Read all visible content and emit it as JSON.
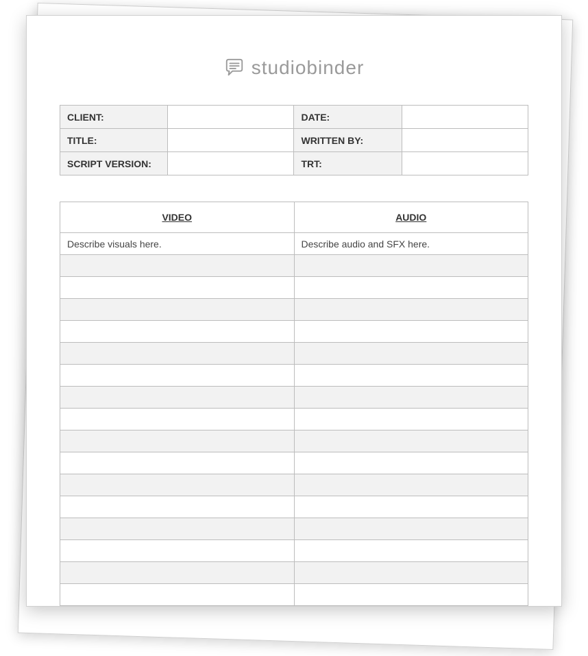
{
  "brand": {
    "name": "studiobinder"
  },
  "meta": {
    "rows": [
      {
        "label1": "CLIENT:",
        "value1": "",
        "label2": "DATE:",
        "value2": ""
      },
      {
        "label1": "TITLE:",
        "value1": "",
        "label2": "WRITTEN BY:",
        "value2": ""
      },
      {
        "label1": "SCRIPT VERSION:",
        "value1": "",
        "label2": "TRT:",
        "value2": ""
      }
    ]
  },
  "script": {
    "headers": {
      "video": "VIDEO",
      "audio": "AUDIO"
    },
    "rows": [
      {
        "video": "Describe visuals here.",
        "audio": "Describe audio and SFX here."
      },
      {
        "video": "",
        "audio": ""
      },
      {
        "video": "",
        "audio": ""
      },
      {
        "video": "",
        "audio": ""
      },
      {
        "video": "",
        "audio": ""
      },
      {
        "video": "",
        "audio": ""
      },
      {
        "video": "",
        "audio": ""
      },
      {
        "video": "",
        "audio": ""
      },
      {
        "video": "",
        "audio": ""
      },
      {
        "video": "",
        "audio": ""
      },
      {
        "video": "",
        "audio": ""
      },
      {
        "video": "",
        "audio": ""
      },
      {
        "video": "",
        "audio": ""
      },
      {
        "video": "",
        "audio": ""
      },
      {
        "video": "",
        "audio": ""
      },
      {
        "video": "",
        "audio": ""
      },
      {
        "video": "",
        "audio": ""
      }
    ]
  }
}
